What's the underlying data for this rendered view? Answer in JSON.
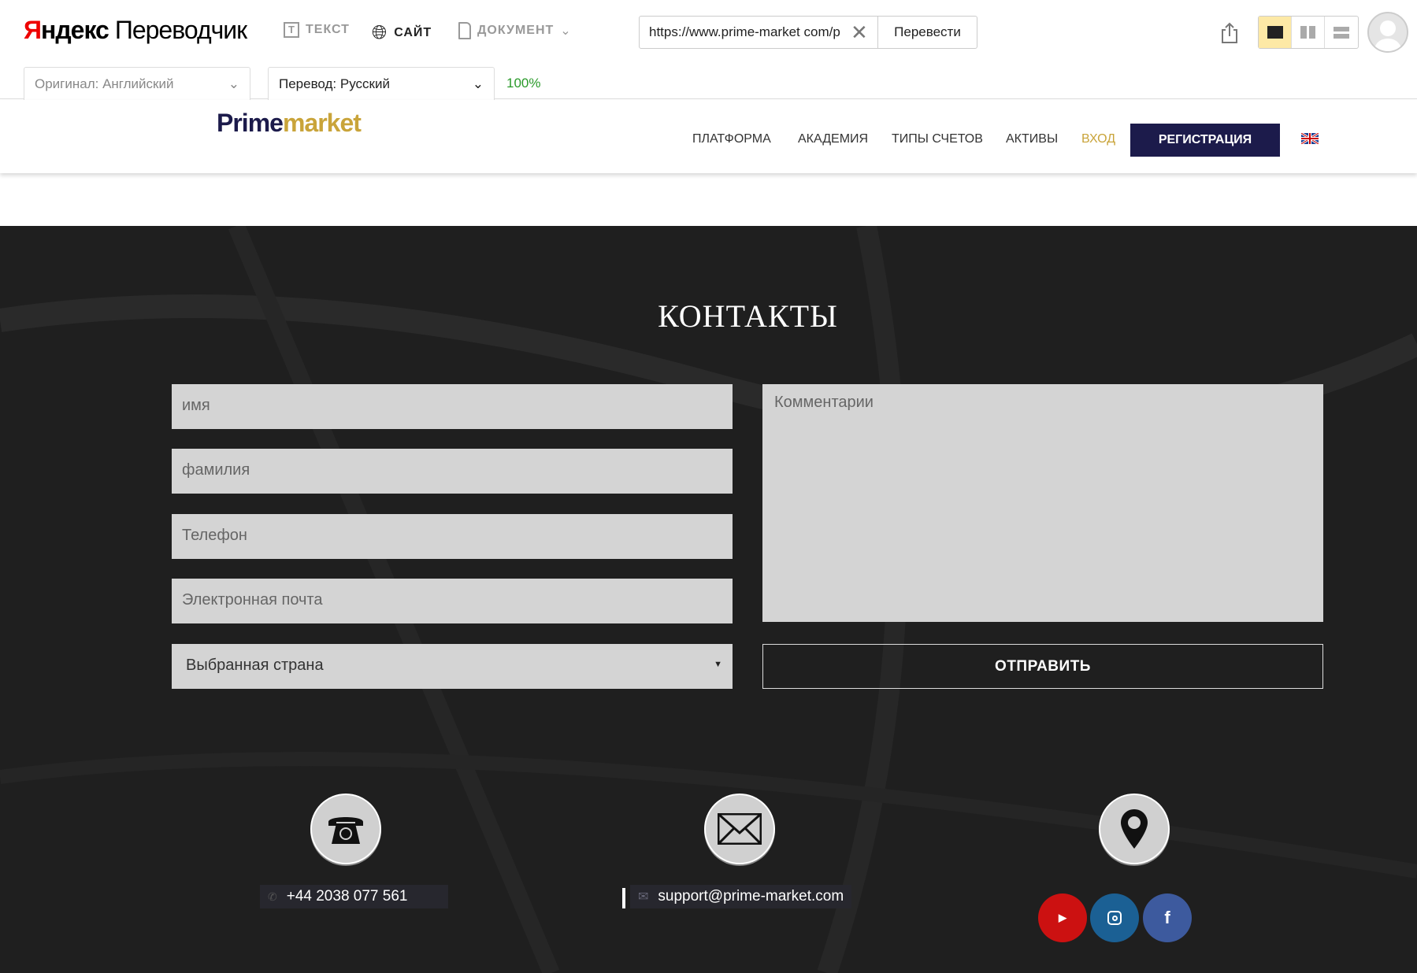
{
  "translator": {
    "logo_brand": "Яндекс",
    "logo_product": "Переводчик",
    "modes": [
      {
        "label": "ТЕКСТ"
      },
      {
        "label": "САЙТ"
      },
      {
        "label": "ДОКУМЕНТ"
      }
    ],
    "url_value": "https://www.prime-market com/p",
    "translate_label": "Перевести",
    "source_lang": "Оригинал: Английский",
    "target_lang": "Перевод: Русский",
    "progress": "100%"
  },
  "site": {
    "brand_p": "P",
    "brand_rime": "rime",
    "brand_market": "market",
    "nav": [
      "ПЛАТФОРМА",
      "АКАДЕМИЯ",
      "ТИПЫ СЧЕТОВ",
      "АКТИВЫ"
    ],
    "login": "ВХОД",
    "register": "РЕГИСТРАЦИЯ",
    "accent": "#c9a43a",
    "nav_dark": "#1c1b4b"
  },
  "contacts": {
    "title": "КОНТАКТЫ",
    "fields": {
      "first_name": "имя",
      "last_name": "фамилия",
      "phone": "Телефон",
      "email": "Электронная почта",
      "comment": "Комментарии"
    },
    "country": "Выбранная страна",
    "submit": "ОТПРАВИТЬ",
    "phone": "+44 2038 077 561",
    "email": "support@prime-market.com",
    "social": [
      {
        "name": "youtube",
        "color": "#cc1111"
      },
      {
        "name": "instagram",
        "color": "#1b6094"
      },
      {
        "name": "facebook",
        "color": "#3d5a9e"
      }
    ]
  }
}
